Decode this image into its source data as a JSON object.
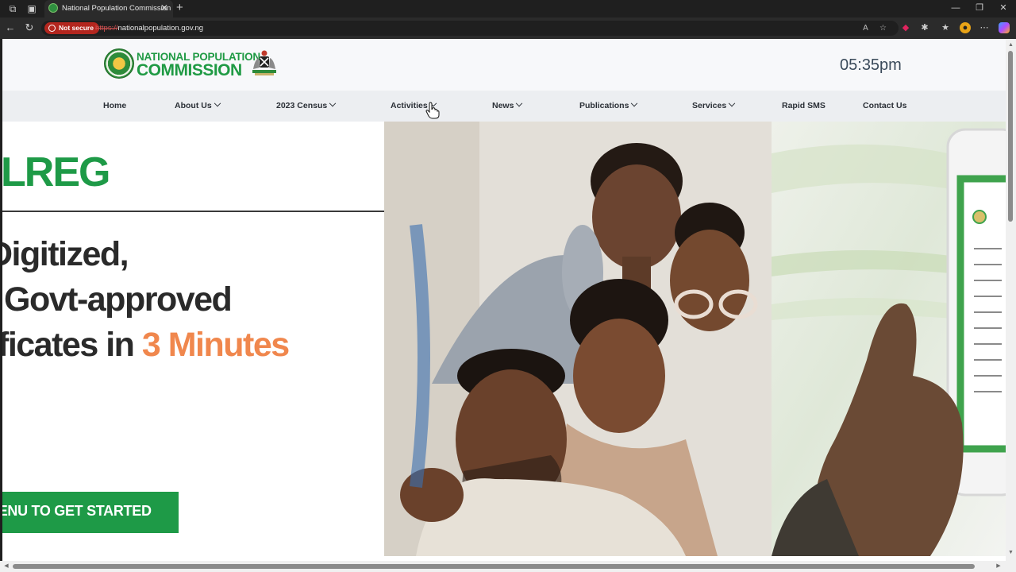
{
  "browser": {
    "tab_title": "National Population Commission",
    "security_label": "Not secure",
    "url_scheme": "https://",
    "url_host": "nationalpopulation.gov.ng"
  },
  "site": {
    "logo_line1": "NATIONAL POPULATION",
    "logo_line2": "COMMISSION",
    "clock_hours": "05:",
    "clock_rest": "35pm",
    "nav": [
      {
        "label": "Home",
        "dropdown": false
      },
      {
        "label": "About Us",
        "dropdown": true
      },
      {
        "label": "2023 Census",
        "dropdown": true
      },
      {
        "label": "Activities",
        "dropdown": true
      },
      {
        "label": "News",
        "dropdown": true
      },
      {
        "label": "Publications",
        "dropdown": true
      },
      {
        "label": "Services",
        "dropdown": true
      },
      {
        "label": "Rapid SMS",
        "dropdown": false
      },
      {
        "label": "Contact Us",
        "dropdown": false
      }
    ]
  },
  "hero": {
    "brand": "LREG",
    "line1": "Digitized,",
    "line2": "Govt-approved",
    "line3_prefix": "ficates in ",
    "line3_accent": "3 Minutes",
    "cta_label": "MENU TO GET STARTED"
  },
  "colors": {
    "brand_green": "#1e9a47",
    "accent_orange": "#f0874d"
  }
}
